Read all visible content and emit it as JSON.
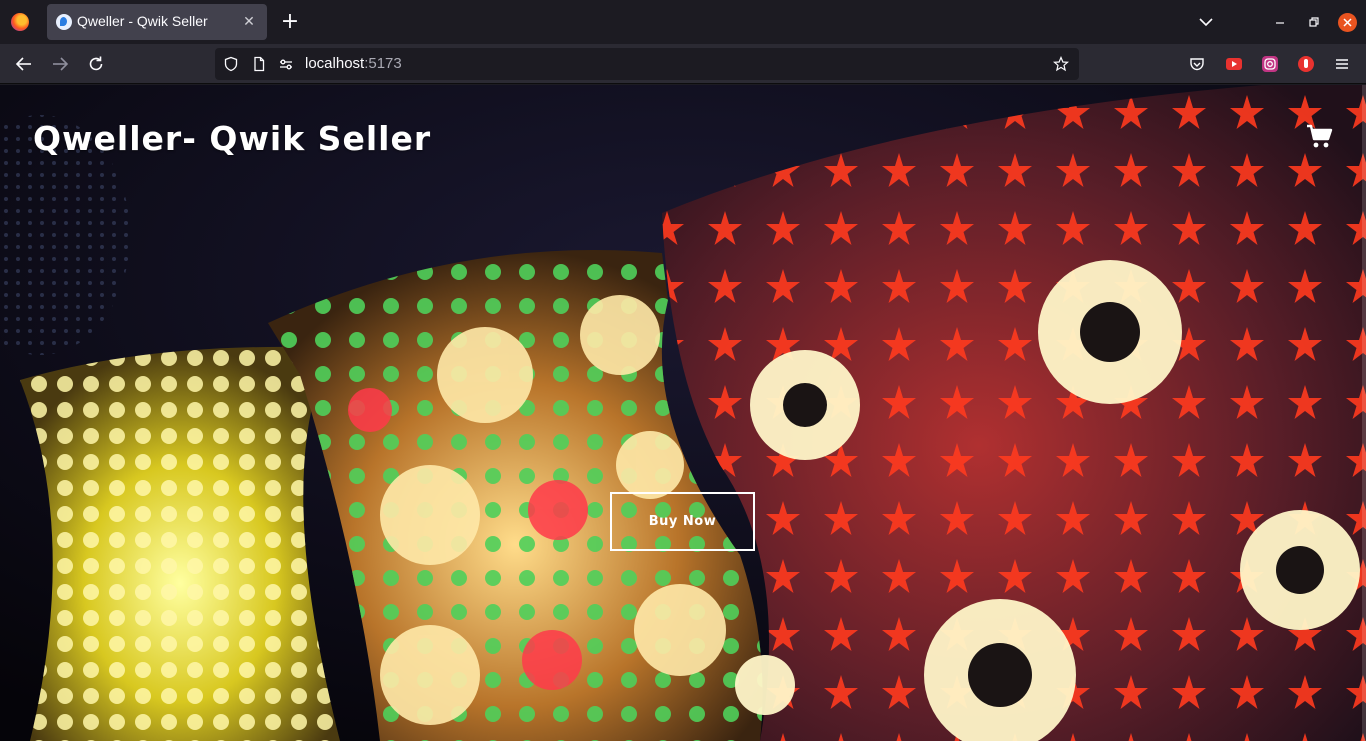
{
  "browser": {
    "tab": {
      "title": "Qweller - Qwik Seller",
      "close_glyph": "✕"
    },
    "new_tab_glyph": "+",
    "url": {
      "host": "localhost",
      "port": ":5173"
    }
  },
  "site": {
    "title": "Qweller- Qwik Seller",
    "buy_button_label": "Buy Now",
    "hero_image": "mosaic-lamps-photo"
  },
  "colors": {
    "tab_active": "#42414d",
    "toolbar": "#2b2a33",
    "urlbar": "#1c1b22",
    "window_close": "#e95420"
  }
}
